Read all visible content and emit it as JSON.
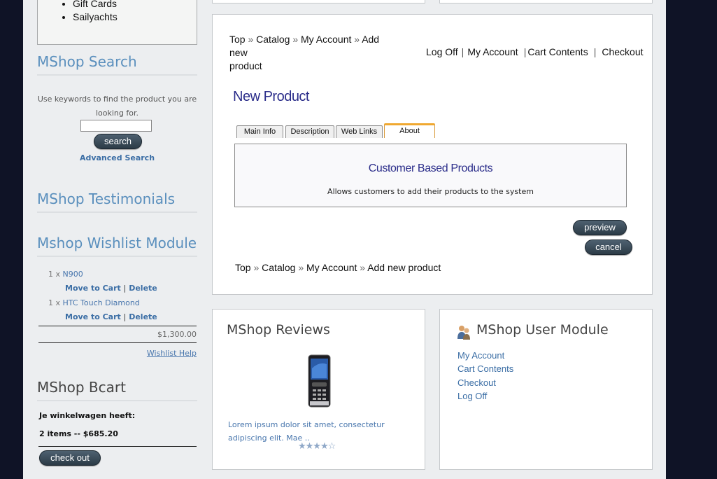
{
  "categories": [
    "Gift Cards",
    "Sailyachts"
  ],
  "search": {
    "title": "MShop Search",
    "hint": "Use keywords to find the product you are looking for.",
    "button": "search",
    "advanced": "Advanced Search",
    "placeholder": ""
  },
  "testimonials": {
    "title": "MShop Testimonials"
  },
  "wishlist": {
    "title": "Mshop Wishlist Module",
    "items": [
      {
        "qty": "1 x",
        "name": "N900",
        "move": "Move to Cart",
        "sep": "|",
        "delete": "Delete"
      },
      {
        "qty": "1 x",
        "name": "HTC Touch Diamond",
        "move": "Move to Cart",
        "sep": "|",
        "delete": "Delete"
      }
    ],
    "total": "$1,300.00",
    "help": "Wishlist Help"
  },
  "bcart": {
    "title": "MShop Bcart",
    "line1": "Je winkelwagen heeft:",
    "line2": "2 items -- $685.20",
    "checkout": "check out"
  },
  "breadcrumb": {
    "items": [
      "Top",
      "Catalog",
      "My Account",
      "Add new"
    ],
    "wrap": "product",
    "bottom_items": [
      "Top",
      "Catalog",
      "My Account",
      "Add new product"
    ],
    "separator": "»"
  },
  "toplinks": [
    "Log Off",
    "My Account",
    "Cart Contents",
    "Checkout"
  ],
  "toplinks_sep": "|",
  "product": {
    "title": "New Product",
    "tabs": [
      "Main Info",
      "Description",
      "Web Links",
      "About"
    ],
    "active_tab": "About",
    "panel_title": "Customer Based Products",
    "panel_desc": "Allows customers to add their products to the system",
    "preview": "preview",
    "cancel": "cancel"
  },
  "reviews": {
    "title": "MShop Reviews",
    "text": "Lorem ipsum dolor sit amet, consectetur adipiscing elit. Mae ..",
    "stars": "★★★★☆",
    "rating": 4,
    "rating_max": 5
  },
  "user_module": {
    "title": "MShop User Module",
    "links": [
      "My Account",
      "Cart Contents",
      "Checkout",
      "Log Off"
    ]
  }
}
